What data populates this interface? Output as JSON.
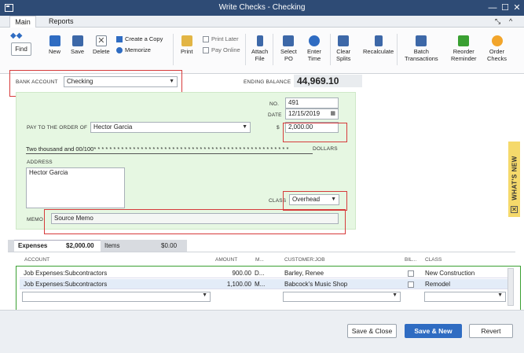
{
  "window": {
    "title": "Write Checks - Checking",
    "minimize": "—",
    "maximize": "☐",
    "close": "✕"
  },
  "tabs": [
    "Main",
    "Reports"
  ],
  "tab_controls": {
    "expand": "⤡",
    "collapse": "^"
  },
  "toolbar": {
    "find": "Find",
    "new": "New",
    "save": "Save",
    "delete": "Delete",
    "create_copy": "Create a Copy",
    "memorize": "Memorize",
    "print": "Print",
    "print_later": "Print Later",
    "pay_online": "Pay Online",
    "attach_file": [
      "Attach",
      "File"
    ],
    "select_po": [
      "Select",
      "PO"
    ],
    "enter_time": [
      "Enter",
      "Time"
    ],
    "clear_splits": [
      "Clear",
      "Splits"
    ],
    "recalculate": "Recalculate",
    "batch_transactions": [
      "Batch",
      "Transactions"
    ],
    "reorder_reminder": [
      "Reorder",
      "Reminder"
    ],
    "order_checks": [
      "Order",
      "Checks"
    ]
  },
  "bank": {
    "label": "BANK ACCOUNT",
    "value": "Checking",
    "ending_label": "ENDING BALANCE",
    "ending_balance": "44,969.10"
  },
  "check": {
    "no_label": "NO.",
    "no": "491",
    "date_label": "DATE",
    "date": "12/15/2019",
    "payee_label": "PAY TO THE ORDER OF",
    "payee": "Hector Garcia",
    "dollar_sign": "$",
    "amount": "2,000.00",
    "amount_words": "Two thousand  and 00/100* * * * * * * * * * * * * * * * * * * * * * * * * * * * * * * * * * * * * * * * * * * * * * * * * *",
    "dollars_label": "DOLLARS",
    "address_label": "ADDRESS",
    "address": "Hector Garcia",
    "class_label": "CLASS",
    "class_value": "Overhead",
    "memo_label": "MEMO",
    "memo": "Source Memo"
  },
  "whats_new": "WHAT'S NEW",
  "expense_tabs": {
    "expenses_label": "Expenses",
    "expenses_amount": "$2,000.00",
    "items_label": "Items",
    "items_amount": "$0.00"
  },
  "grid": {
    "headers": [
      "ACCOUNT",
      "AMOUNT",
      "M...",
      "CUSTOMER:JOB",
      "BIL...",
      "CLASS"
    ],
    "rows": [
      {
        "account": "Job Expenses:Subcontractors",
        "amount": "900.00",
        "memo": "D...",
        "customer": "Barley, Renee",
        "class": "New Construction"
      },
      {
        "account": "Job Expenses:Subcontractors",
        "amount": "1,100.00",
        "memo": "M...",
        "customer": "Babcock's Music Shop",
        "class": "Remodel"
      }
    ]
  },
  "buttons": {
    "save_close": "Save & Close",
    "save_new": "Save & New",
    "revert": "Revert"
  },
  "colors": {
    "titlebar": "#2e4b75",
    "check_bg": "#e6f7e2",
    "highlight_red": "#d63b3b",
    "highlight_green": "#3aa032",
    "accent_blue": "#2f6cc2"
  }
}
